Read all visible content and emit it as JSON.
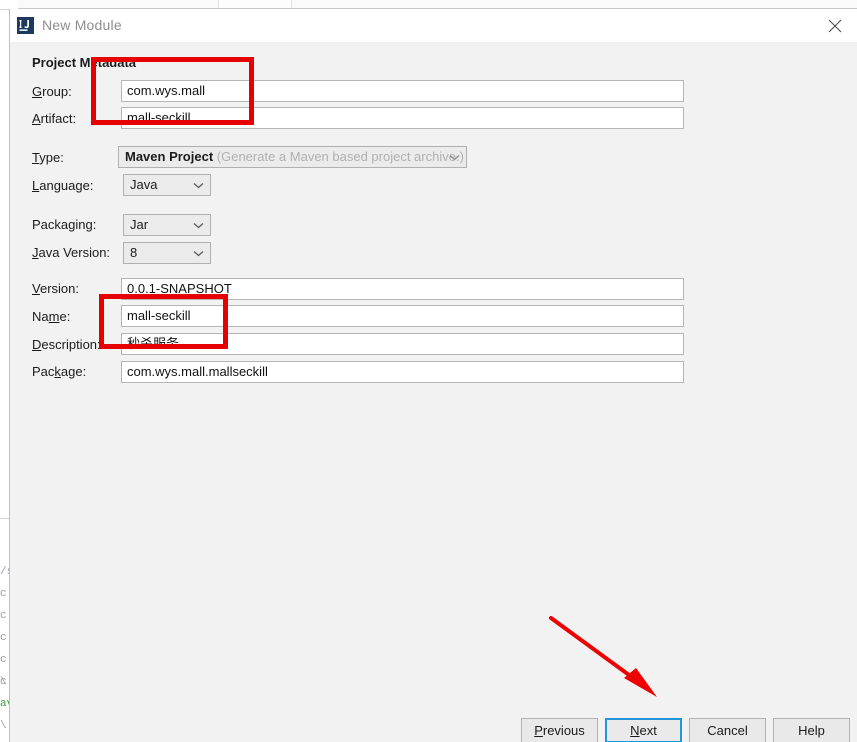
{
  "window": {
    "title": "New Module",
    "icon": "intellij-idea-icon",
    "close_icon": "close-icon"
  },
  "section": {
    "title": "Project Metadata"
  },
  "fields": [
    {
      "id": "group",
      "label_pre": "",
      "label_mn": "G",
      "label_post": "roup:",
      "value": "com.wys.mall",
      "control": "text"
    },
    {
      "id": "artifact",
      "label_pre": "",
      "label_mn": "A",
      "label_post": "rtifact:",
      "value": "mall-seckill",
      "control": "text"
    },
    {
      "id": "type",
      "label_pre": "",
      "label_mn": "T",
      "label_post": "ype:",
      "value": "Maven Project",
      "hint": "(Generate a Maven based project archive.)",
      "control": "combo-wide",
      "disabled": true
    },
    {
      "id": "language",
      "label_pre": "",
      "label_mn": "L",
      "label_post": "anguage:",
      "value": "Java",
      "control": "combo"
    },
    {
      "id": "packaging",
      "label_pre": "Packa",
      "label_mn": "g",
      "label_post": "ing:",
      "value": "Jar",
      "control": "combo"
    },
    {
      "id": "java-version",
      "label_pre": "",
      "label_mn": "J",
      "label_post": "ava Version:",
      "value": "8",
      "control": "combo"
    },
    {
      "id": "version",
      "label_pre": "",
      "label_mn": "V",
      "label_post": "ersion:",
      "value": "0.0.1-SNAPSHOT",
      "control": "text"
    },
    {
      "id": "name",
      "label_pre": "Na",
      "label_mn": "m",
      "label_post": "e:",
      "value": "mall-seckill",
      "control": "text"
    },
    {
      "id": "description",
      "label_pre": "",
      "label_mn": "D",
      "label_post": "escription:",
      "value": "秒杀服务",
      "control": "text"
    },
    {
      "id": "package",
      "label_pre": "Pac",
      "label_mn": "k",
      "label_post": "age:",
      "value": "com.wys.mall.mallseckill",
      "control": "text"
    }
  ],
  "buttons": [
    {
      "id": "previous",
      "pre": "",
      "mn": "P",
      "post": "revious",
      "focused": false
    },
    {
      "id": "next",
      "pre": "",
      "mn": "N",
      "post": "ext",
      "focused": true
    },
    {
      "id": "cancel",
      "pre": "Cancel",
      "mn": "",
      "post": "",
      "focused": false
    },
    {
      "id": "help",
      "pre": "Help",
      "mn": "",
      "post": "",
      "focused": false
    }
  ],
  "annotations": {
    "highlight_color": "#e60000",
    "boxes": [
      {
        "id": "group-artifact-highlight"
      },
      {
        "id": "name-description-highlight"
      }
    ],
    "arrow": {
      "id": "next-button-arrow"
    }
  },
  "background_strip": {
    "lines": [
      "/s",
      "c",
      "c",
      "c",
      "c",
      "c",
      "\\",
      "av",
      "\\"
    ]
  }
}
